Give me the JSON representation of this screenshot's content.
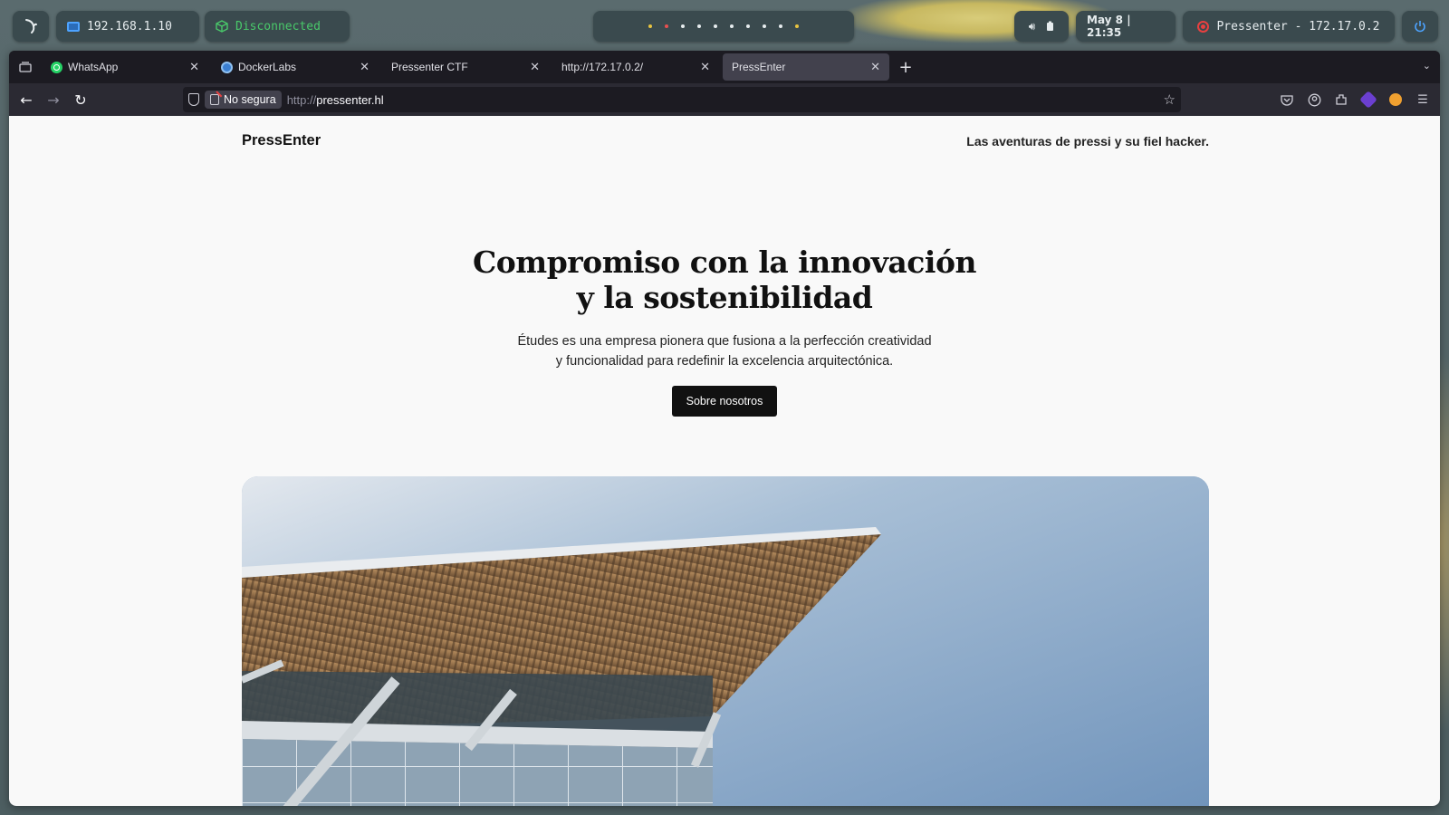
{
  "topbar": {
    "ip": "192.168.1.10",
    "vpn_status": "Disconnected",
    "clock": "May 8 | 21:35",
    "target": "Pressenter - 172.17.0.2"
  },
  "browser": {
    "tabs": [
      {
        "title": "WhatsApp",
        "icon": "whatsapp-icon"
      },
      {
        "title": "DockerLabs",
        "icon": "dockerlabs-icon"
      },
      {
        "title": "Pressenter CTF",
        "icon": ""
      },
      {
        "title": "http://172.17.0.2/",
        "icon": ""
      },
      {
        "title": "PressEnter",
        "icon": "",
        "active": true
      }
    ],
    "url": {
      "security_label": "No segura",
      "scheme": "http://",
      "host": "pressenter.hl"
    }
  },
  "site": {
    "logo": "PressEnter",
    "tagline": "Las aventuras de pressi y su fiel hacker.",
    "hero_title_line1": "Compromiso con la innovación",
    "hero_title_line2": "y la sostenibilidad",
    "hero_text_line1": "Études es una empresa pionera que fusiona a la perfección creatividad",
    "hero_text_line2": "y funcionalidad para redefinir la excelencia arquitectónica.",
    "cta_label": "Sobre nosotros"
  },
  "colors": {
    "vpn_disconnected": "#49c96a",
    "target_red": "#e84040",
    "cta_bg": "#111111"
  }
}
